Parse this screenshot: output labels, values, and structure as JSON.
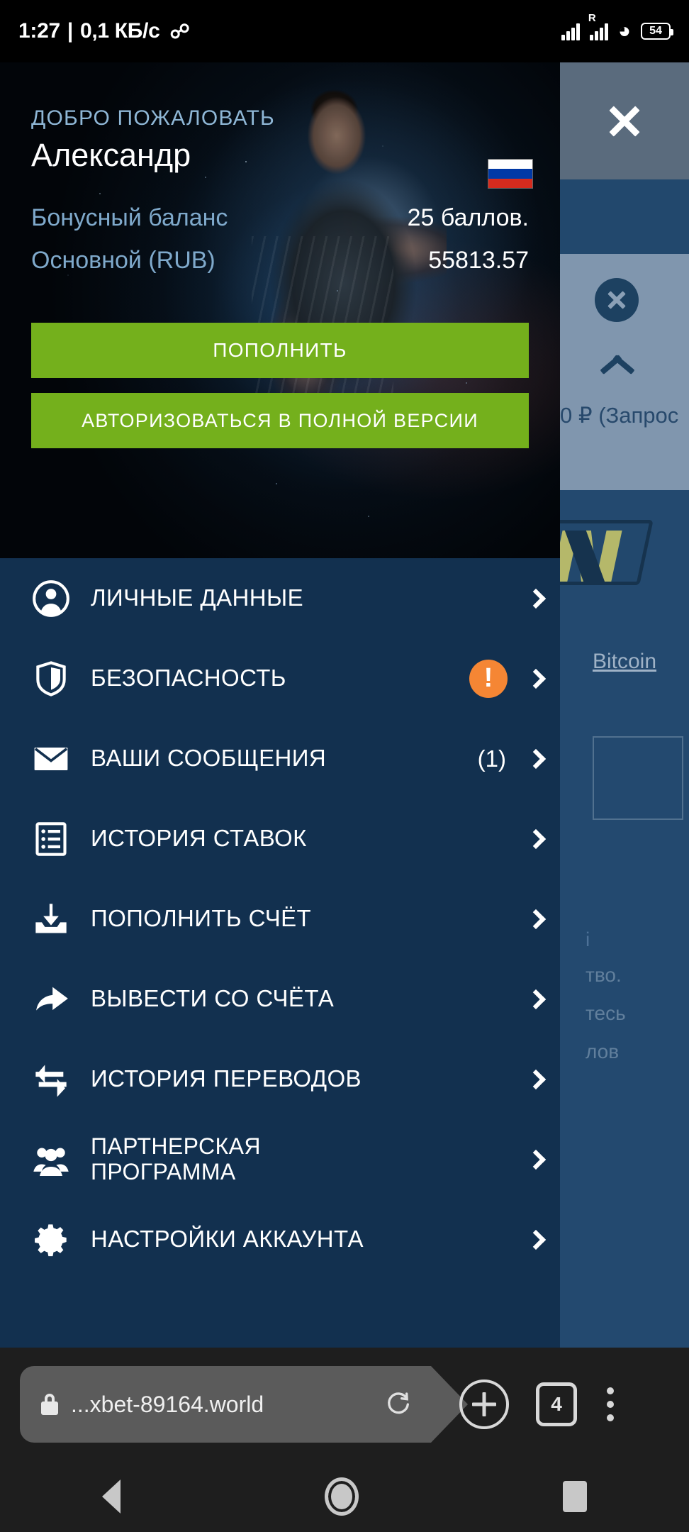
{
  "status_bar": {
    "time": "1:27",
    "separator": "|",
    "net_speed": "0,1 КБ/с",
    "mail_icon": "gmail-icon",
    "roaming_label": "R",
    "battery_level": "54"
  },
  "drawer": {
    "welcome_label": "ДОБРО ПОЖАЛОВАТЬ",
    "user_name": "Александр",
    "flag": "russia-flag",
    "bonus_label": "Бонусный баланс",
    "bonus_value": "25 баллов.",
    "main_label": "Основной (RUB)",
    "main_value": "55813.57",
    "deposit_button": "ПОПОЛНИТЬ",
    "full_version_button": "АВТОРИЗОВАТЬСЯ В ПОЛНОЙ ВЕРСИИ",
    "accent_green": "#74b01c",
    "menu_bg": "#12304f",
    "badge_orange": "#f58634",
    "items": [
      {
        "label": "ЛИЧНЫЕ ДАННЫЕ",
        "icon": "user-icon",
        "badge": "",
        "count": ""
      },
      {
        "label": "БЕЗОПАСНОСТЬ",
        "icon": "shield-icon",
        "badge": "!",
        "count": ""
      },
      {
        "label": "ВАШИ СООБЩЕНИЯ",
        "icon": "envelope-icon",
        "badge": "",
        "count": "(1)"
      },
      {
        "label": "ИСТОРИЯ СТАВОК",
        "icon": "list-icon",
        "badge": "",
        "count": ""
      },
      {
        "label": "ПОПОЛНИТЬ СЧЁТ",
        "icon": "deposit-icon",
        "badge": "",
        "count": ""
      },
      {
        "label": "ВЫВЕСТИ СО СЧЁТА",
        "icon": "withdraw-icon",
        "badge": "",
        "count": ""
      },
      {
        "label": "ИСТОРИЯ ПЕРЕВОДОВ",
        "icon": "transfer-icon",
        "badge": "",
        "count": ""
      },
      {
        "label": "ПАРТНЕРСКАЯ\nПРОГРАММА",
        "icon": "people-icon",
        "badge": "",
        "count": ""
      },
      {
        "label": "НАСТРОЙКИ АККАУНТА",
        "icon": "gear-icon",
        "badge": "",
        "count": ""
      }
    ]
  },
  "background_page": {
    "close_icon": "close-icon",
    "circle_close_icon": "circle-close-icon",
    "collapse_icon": "chevron-up-icon",
    "amount_text": "0 ₽ (Запрос",
    "sponsor_logo": "navi-logo",
    "bitcoin_link": "Bitcoin",
    "text_fragment_1": "і",
    "text_fragment_2": "тво.",
    "text_fragment_3": "тесь",
    "text_fragment_4": "лов"
  },
  "browser": {
    "lock_icon": "lock-icon",
    "url": "...xbet-89164.world",
    "reload_icon": "reload-icon",
    "new_tab_icon": "plus-icon",
    "tab_count": "4",
    "menu_icon": "three-dots-icon"
  },
  "android_nav": {
    "back_icon": "back-triangle-icon",
    "home_icon": "home-circle-icon",
    "recents_icon": "recents-square-icon"
  }
}
